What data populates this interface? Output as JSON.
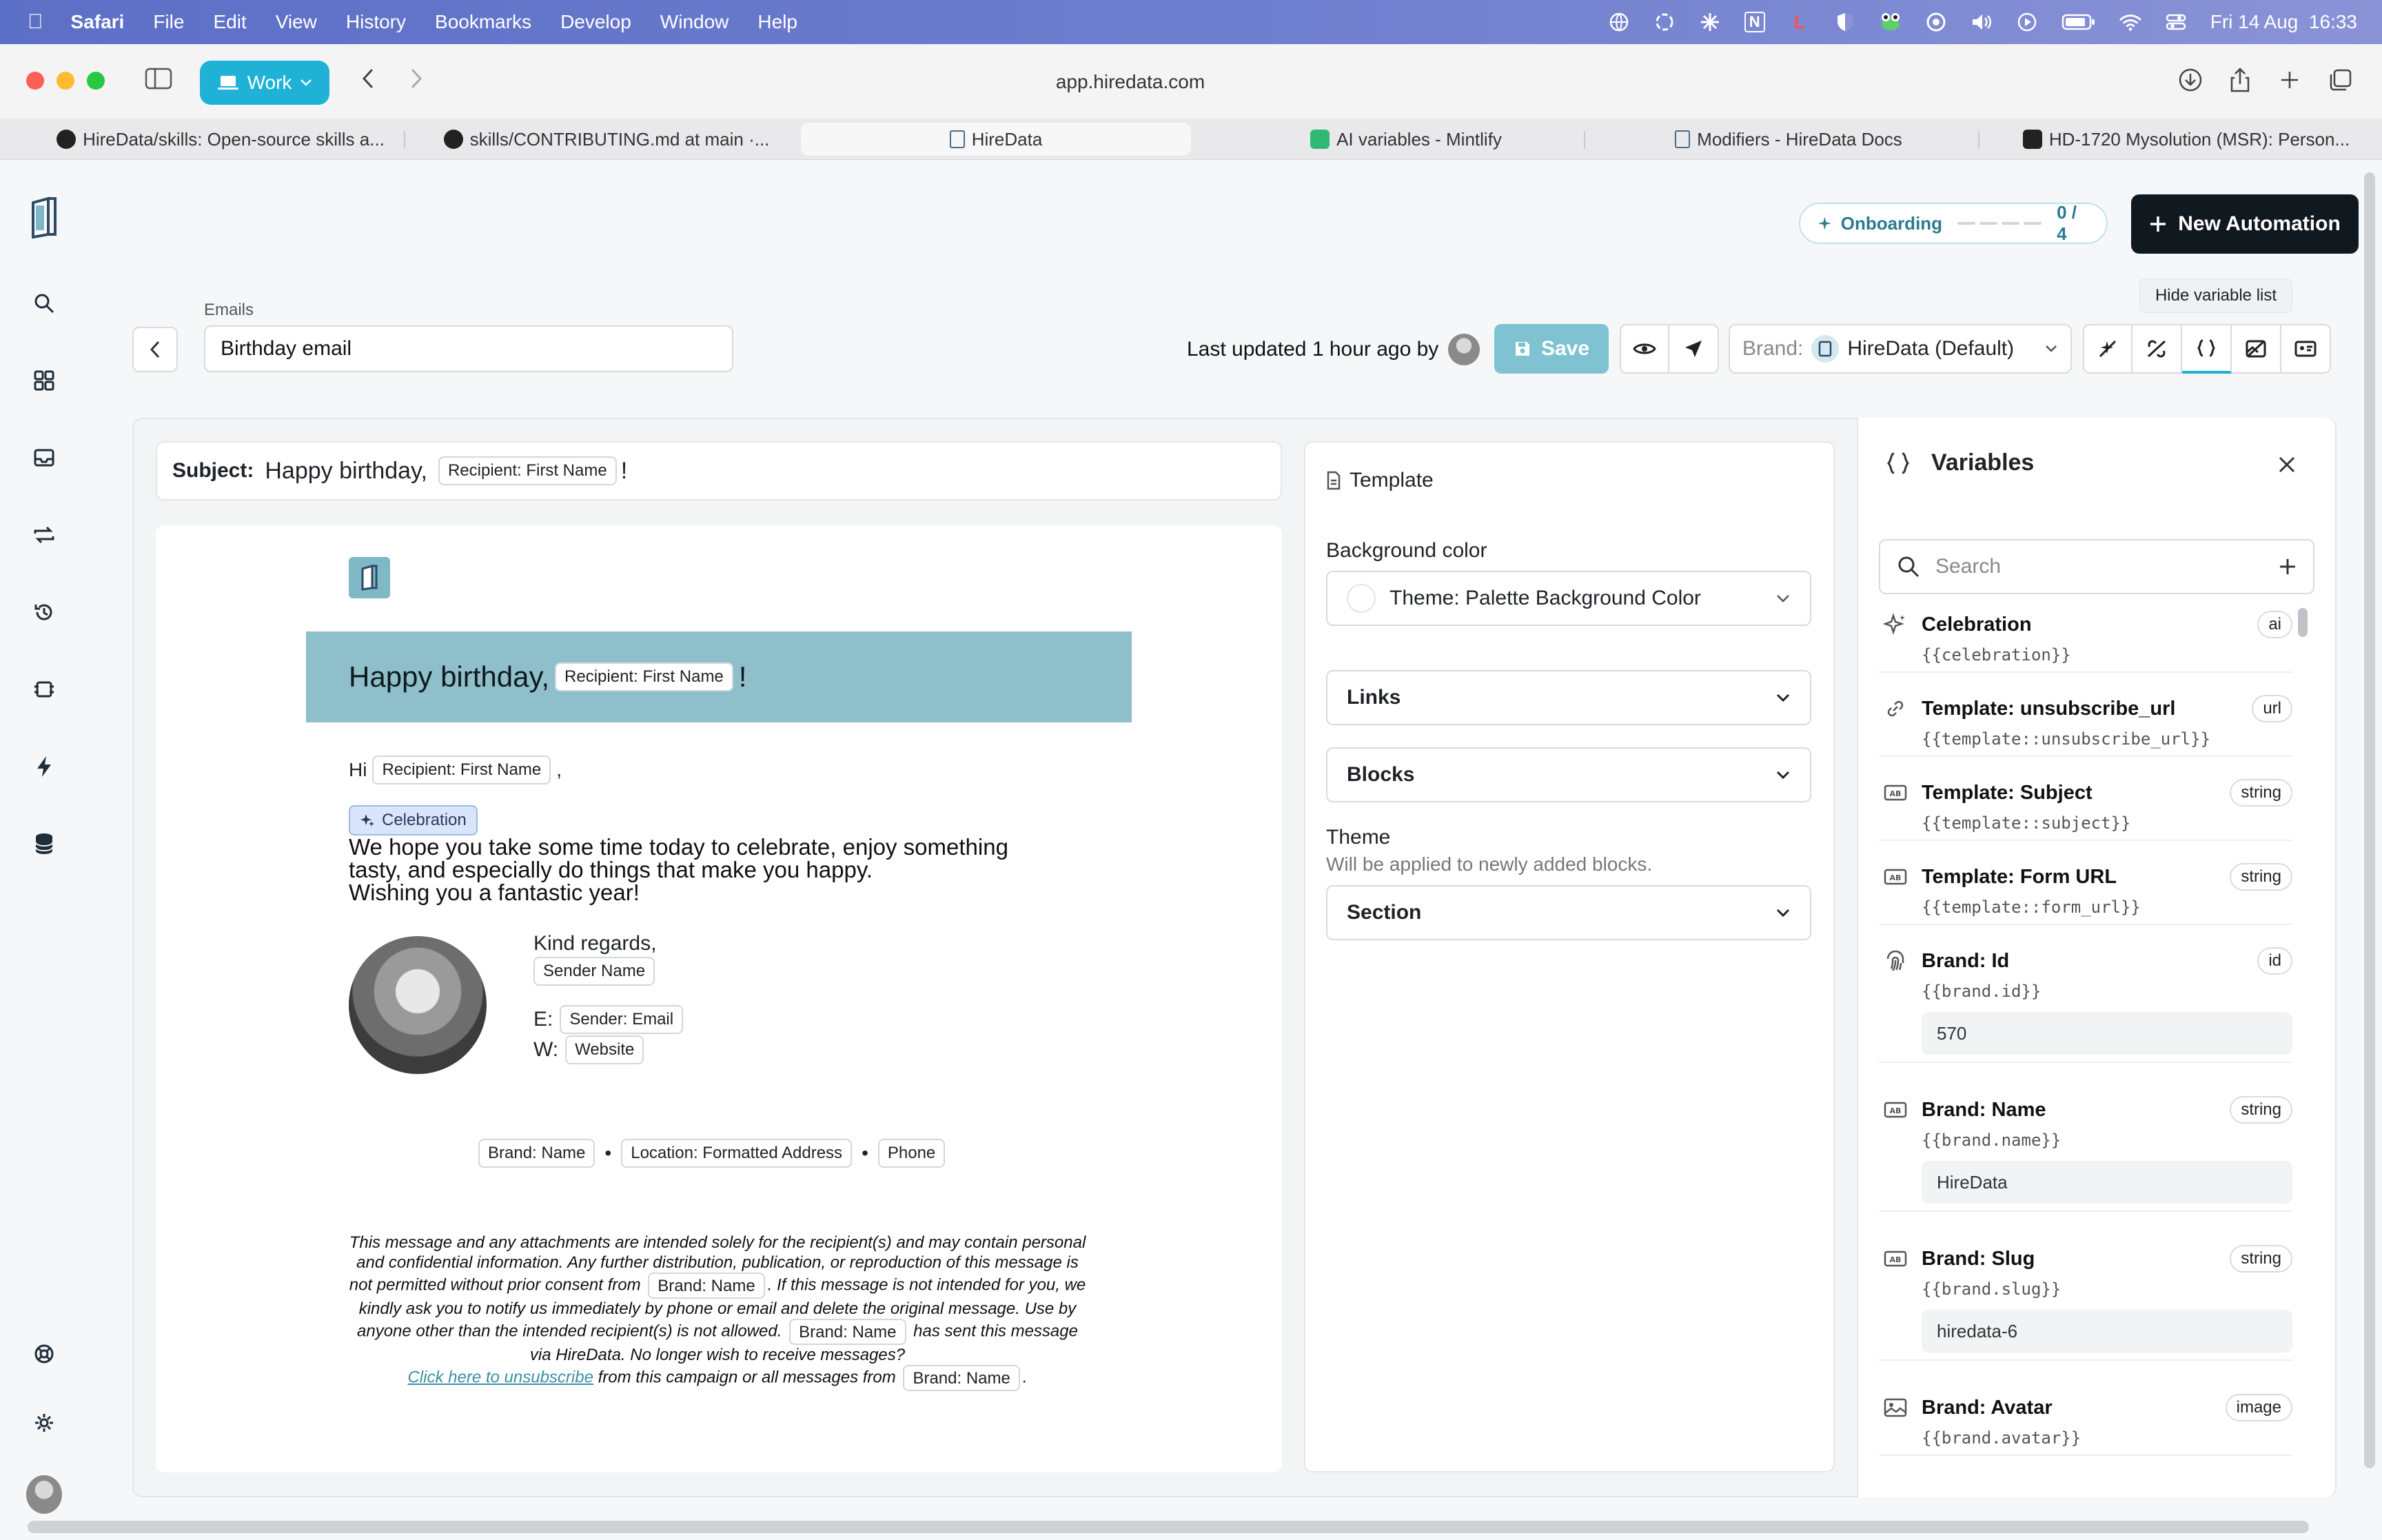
{
  "menubar": {
    "app": "Safari",
    "items": [
      "File",
      "Edit",
      "View",
      "History",
      "Bookmarks",
      "Develop",
      "Window",
      "Help"
    ],
    "datetime": "Fri 14 Aug  16:33",
    "tray_icon_letter": "N",
    "tray_icon_letter2": "L"
  },
  "toolbar": {
    "workspace": "Work",
    "url": "app.hiredata.com"
  },
  "tabs": [
    {
      "label": "HireData/skills: Open-source skills a...",
      "active": false
    },
    {
      "label": "skills/CONTRIBUTING.md at main ·...",
      "active": false
    },
    {
      "label": "HireData",
      "active": true
    },
    {
      "label": "AI variables - Mintlify",
      "active": false
    },
    {
      "label": "Modifiers - HireData Docs",
      "active": false
    },
    {
      "label": "HD-1720 Mysolution (MSR): Person...",
      "active": false
    }
  ],
  "header": {
    "onboarding_label": "Onboarding",
    "onboarding_progress": "0 / 4",
    "new_automation": "New Automation",
    "tooltip": "Hide variable list"
  },
  "editor_bar": {
    "section_label": "Emails",
    "email_name": "Birthday email",
    "last_updated": "Last updated 1 hour ago by",
    "save": "Save",
    "brand_label": "Brand:",
    "brand_value": "HireData (Default)"
  },
  "subject": {
    "label": "Subject:",
    "prefix": "Happy birthday,",
    "pill": "Recipient: First Name",
    "suffix": "!"
  },
  "email": {
    "banner_text": "Happy birthday,",
    "banner_pill": "Recipient: First Name",
    "banner_suffix": "!",
    "hi": "Hi",
    "hi_pill": "Recipient: First Name",
    "hi_suffix": ",",
    "celebration_pill": "Celebration",
    "body_lines": [
      "We hope you take some time today to celebrate, enjoy something",
      "tasty, and especially do things that make you happy.",
      "Wishing you a fantastic year!"
    ],
    "kind_regards": "Kind regards,",
    "sender_name_pill": "Sender Name",
    "e_label": "E:",
    "sender_email_pill": "Sender: Email",
    "w_label": "W:",
    "website_pill": "Website",
    "footer_pills": [
      "Brand: Name",
      "Location: Formatted Address",
      "Phone"
    ],
    "footer_sep": "•",
    "legal_1": "This message and any attachments are intended solely for the recipient(s) and may contain personal and confidential information. Any further distribution, publication, or reproduction of this message is not permitted without prior consent from",
    "legal_pill_1": "Brand: Name",
    "legal_2": ". If this message is not intended for you, we kindly ask you to notify us immediately by phone or email and delete the original message. Use by anyone other than the intended recipient(s) is not allowed.",
    "legal_pill_2": "Brand: Name",
    "legal_3": "has sent this message via HireData. No longer wish to receive messages?",
    "unsubscribe_link": "Click here to unsubscribe",
    "legal_4": "from this campaign or all messages from",
    "legal_pill_3": "Brand: Name",
    "legal_5": "."
  },
  "template_panel": {
    "title": "Template",
    "background_color_label": "Background color",
    "background_color_value": "Theme: Palette Background Color",
    "links": "Links",
    "blocks": "Blocks",
    "theme_label": "Theme",
    "theme_hint": "Will be applied to newly added blocks.",
    "theme_value": "Section"
  },
  "variables_panel": {
    "title": "Variables",
    "search_placeholder": "Search",
    "items": [
      {
        "name": "Celebration",
        "type": "ai",
        "code": "{{celebration}}",
        "value": null,
        "icon": "sparkle-icon"
      },
      {
        "name": "Template: unsubscribe_url",
        "type": "url",
        "code": "{{template::unsubscribe_url}}",
        "value": null,
        "icon": "link-icon"
      },
      {
        "name": "Template: Subject",
        "type": "string",
        "code": "{{template::subject}}",
        "value": null,
        "icon": "string-icon"
      },
      {
        "name": "Template: Form URL",
        "type": "string",
        "code": "{{template::form_url}}",
        "value": null,
        "icon": "string-icon"
      },
      {
        "name": "Brand: Id",
        "type": "id",
        "code": "{{brand.id}}",
        "value": "570",
        "icon": "fingerprint-icon"
      },
      {
        "name": "Brand: Name",
        "type": "string",
        "code": "{{brand.name}}",
        "value": "HireData",
        "icon": "string-icon"
      },
      {
        "name": "Brand: Slug",
        "type": "string",
        "code": "{{brand.slug}}",
        "value": "hiredata-6",
        "icon": "string-icon"
      },
      {
        "name": "Brand: Avatar",
        "type": "image",
        "code": "{{brand.avatar}}",
        "value": null,
        "icon": "image-icon"
      }
    ]
  },
  "colors": {
    "accent": "#20b2d6",
    "banner": "#8fbfcb",
    "save": "#7fc3d3",
    "dark_button": "#101820"
  }
}
